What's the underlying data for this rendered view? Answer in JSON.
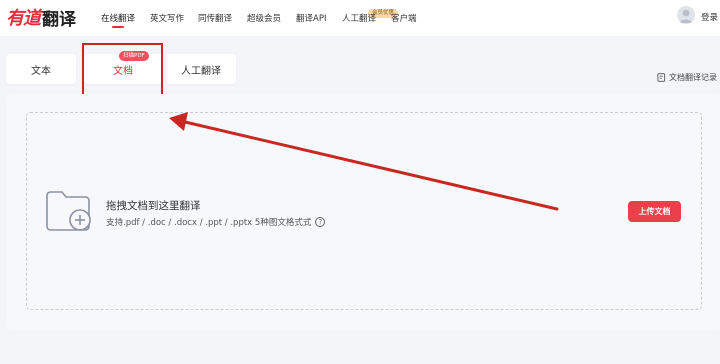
{
  "header": {
    "logo_brand": "有道",
    "logo_product": "翻译",
    "nav": [
      {
        "label": "在线翻译",
        "active": true
      },
      {
        "label": "英文写作",
        "active": false
      },
      {
        "label": "同传翻译",
        "active": false
      },
      {
        "label": "超级会员",
        "active": false
      },
      {
        "label": "翻译API",
        "active": false
      },
      {
        "label": "人工翻译",
        "active": false
      },
      {
        "label": "客户端",
        "active": false
      }
    ],
    "nav_badge": "会员优惠",
    "avatar_icon": "user-avatar-icon",
    "login_label": "登录"
  },
  "tabs": {
    "items": [
      {
        "label": "文本",
        "active": false
      },
      {
        "label": "文档",
        "active": true
      },
      {
        "label": "人工翻译",
        "active": false
      }
    ],
    "doc_badge": "扫描PDF"
  },
  "history": {
    "label": "文档翻译记录",
    "icon": "document-history-icon"
  },
  "upload": {
    "title": "拖拽文档到这里翻译",
    "formats": "支持.pdf / .doc / .docx / .ppt / .pptx 5种图文格式式",
    "help_icon": "?",
    "button_label": "上传文档",
    "folder_icon": "folder-add-icon"
  },
  "colors": {
    "accent": "#e0303a",
    "button": "#eb3f4c",
    "annotation": "#c8281f"
  }
}
